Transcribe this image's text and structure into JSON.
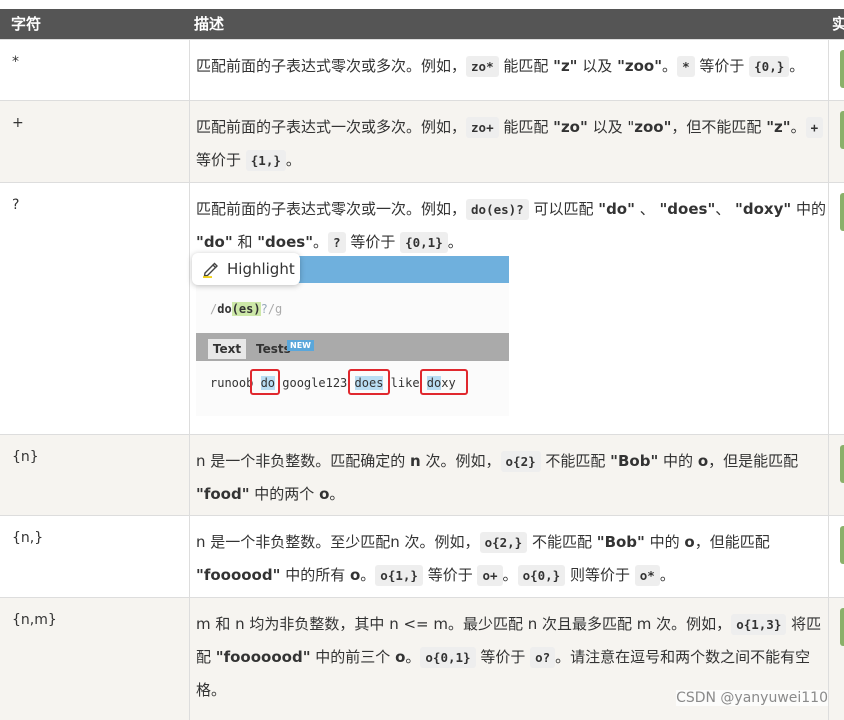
{
  "header": {
    "col1": "字符",
    "col2": "描述",
    "col3": "实"
  },
  "rows": [
    {
      "char": "*"
    },
    {
      "char": "+"
    },
    {
      "char": "?"
    },
    {
      "char": "{n}"
    },
    {
      "char": "{n,}"
    },
    {
      "char": "{n,m}"
    }
  ],
  "desc": {
    "r0": {
      "t1": "匹配前面的子表达式零次或多次。例如，",
      "c1": "zo*",
      "t2": " 能匹配 ",
      "b1": "\"z\"",
      "t3": " 以及 ",
      "b2": "\"zoo\"",
      "t4": "。",
      "c2": "*",
      "t5": " 等价于 ",
      "c3": "{0,}",
      "t6": "。"
    },
    "r1": {
      "t1": "匹配前面的子表达式一次或多次。例如，",
      "c1": "zo+",
      "t2": " 能匹配 ",
      "b1": "\"zo\"",
      "t3": " 以及 \"",
      "b2": "zoo\"",
      "t4": "，但不能匹配 ",
      "b3": "\"z\"",
      "t5": "。",
      "c2": "+",
      "t6": " 等价于 ",
      "c3": "{1,}",
      "t7": "。"
    },
    "r2": {
      "t1": "匹配前面的子表达式零次或一次。例如，",
      "c1": "do(es)?",
      "t2": " 可以匹配 ",
      "b1": "\"do\"",
      "t3": " 、 ",
      "b2": "\"does\"",
      "t4": "、 ",
      "b3": "\"doxy\"",
      "t5": " 中的 ",
      "b4": "\"do\"",
      "t6": " 和 ",
      "b5": "\"does\"",
      "t7": "。",
      "c2": "?",
      "t8": " 等价于 ",
      "c3": "{0,1}",
      "t9": "。"
    },
    "r3": {
      "t1": "n 是一个非负整数。匹配确定的 ",
      "b1": "n",
      "t2": " 次。例如，",
      "c1": "o{2}",
      "t3": " 不能匹配 ",
      "b2": "\"Bob\"",
      "t4": " 中的 ",
      "b3": "o",
      "t5": "，但是能匹配 ",
      "b4": "\"food\"",
      "t6": " 中的两个 ",
      "b5": "o",
      "t7": "。"
    },
    "r4": {
      "t1": "n 是一个非负整数。至少匹配n 次。例如，",
      "c1": "o{2,}",
      "t2": " 不能匹配 ",
      "b1": "\"Bob\"",
      "t3": " 中的 ",
      "b2": "o",
      "t4": "，但能匹配 ",
      "b3": "\"foooood\"",
      "t5": " 中的所有 ",
      "b4": "o",
      "t6": "。",
      "c2": "o{1,}",
      "t7": " 等价于 ",
      "c3": "o+",
      "t8": "。",
      "c4": "o{0,}",
      "t9": " 则等价于 ",
      "c5": "o*",
      "t10": "。"
    },
    "r5": {
      "t1": "m 和 n 均为非负整数，其中 n <= m。最少匹配 n 次且最多匹配 m 次。例如，",
      "c1": "o{1,3}",
      "t2": " 将匹配 ",
      "b1": "\"fooooood\"",
      "t3": " 中的前三个 ",
      "b2": "o",
      "t4": "。",
      "c2": "o{0,1}",
      "t5": " 等价于 ",
      "c3": "o?",
      "t6": "。请注意在逗号和两个数之间不能有空格。"
    }
  },
  "screenshot": {
    "regex_slash1": "/",
    "regex_do": "do",
    "regex_group": "(es)",
    "regex_q": "?",
    "regex_slash2": "/g",
    "tab_text": "Text",
    "tab_tests": "Tests",
    "badge_new": "NEW",
    "sample_1": "runoob ",
    "sample_do": "do",
    "sample_2": " google123 ",
    "sample_does": "does",
    "sample_3": " like ",
    "sample_doxy_m": "do",
    "sample_doxy_r": "xy"
  },
  "highlight_popup": {
    "label": "Highlight",
    "icon": "pen-icon"
  },
  "watermark": "CSDN @yanyuwei110",
  "colors": {
    "header_bg": "#555555",
    "alt_row": "#f6f4f0",
    "green_tab": "#8ab06a",
    "match_box": "#e0282e"
  }
}
